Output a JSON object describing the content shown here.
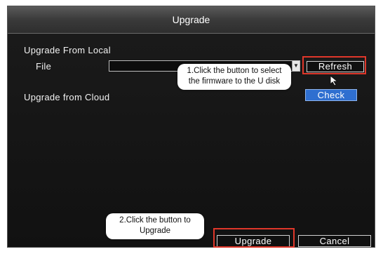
{
  "window": {
    "title": "Upgrade"
  },
  "local": {
    "section_label": "Upgrade From Local",
    "file_label": "File",
    "file_value": "",
    "refresh_label": "Refresh"
  },
  "cloud": {
    "section_label": "Upgrade from Cloud",
    "check_label": "Check"
  },
  "footer": {
    "upgrade_label": "Upgrade",
    "cancel_label": "Cancel"
  },
  "annotations": {
    "callout1_line1": "1.Click the button to select",
    "callout1_line2": "the firmware to the U disk",
    "callout2_line1": "2.Click the button to",
    "callout2_line2": "Upgrade"
  },
  "colors": {
    "highlight": "#e0372a",
    "check_button": "#2f6fd0"
  },
  "icons": {
    "dropdown": "chevron-down-icon",
    "cursor": "cursor-arrow-icon"
  }
}
